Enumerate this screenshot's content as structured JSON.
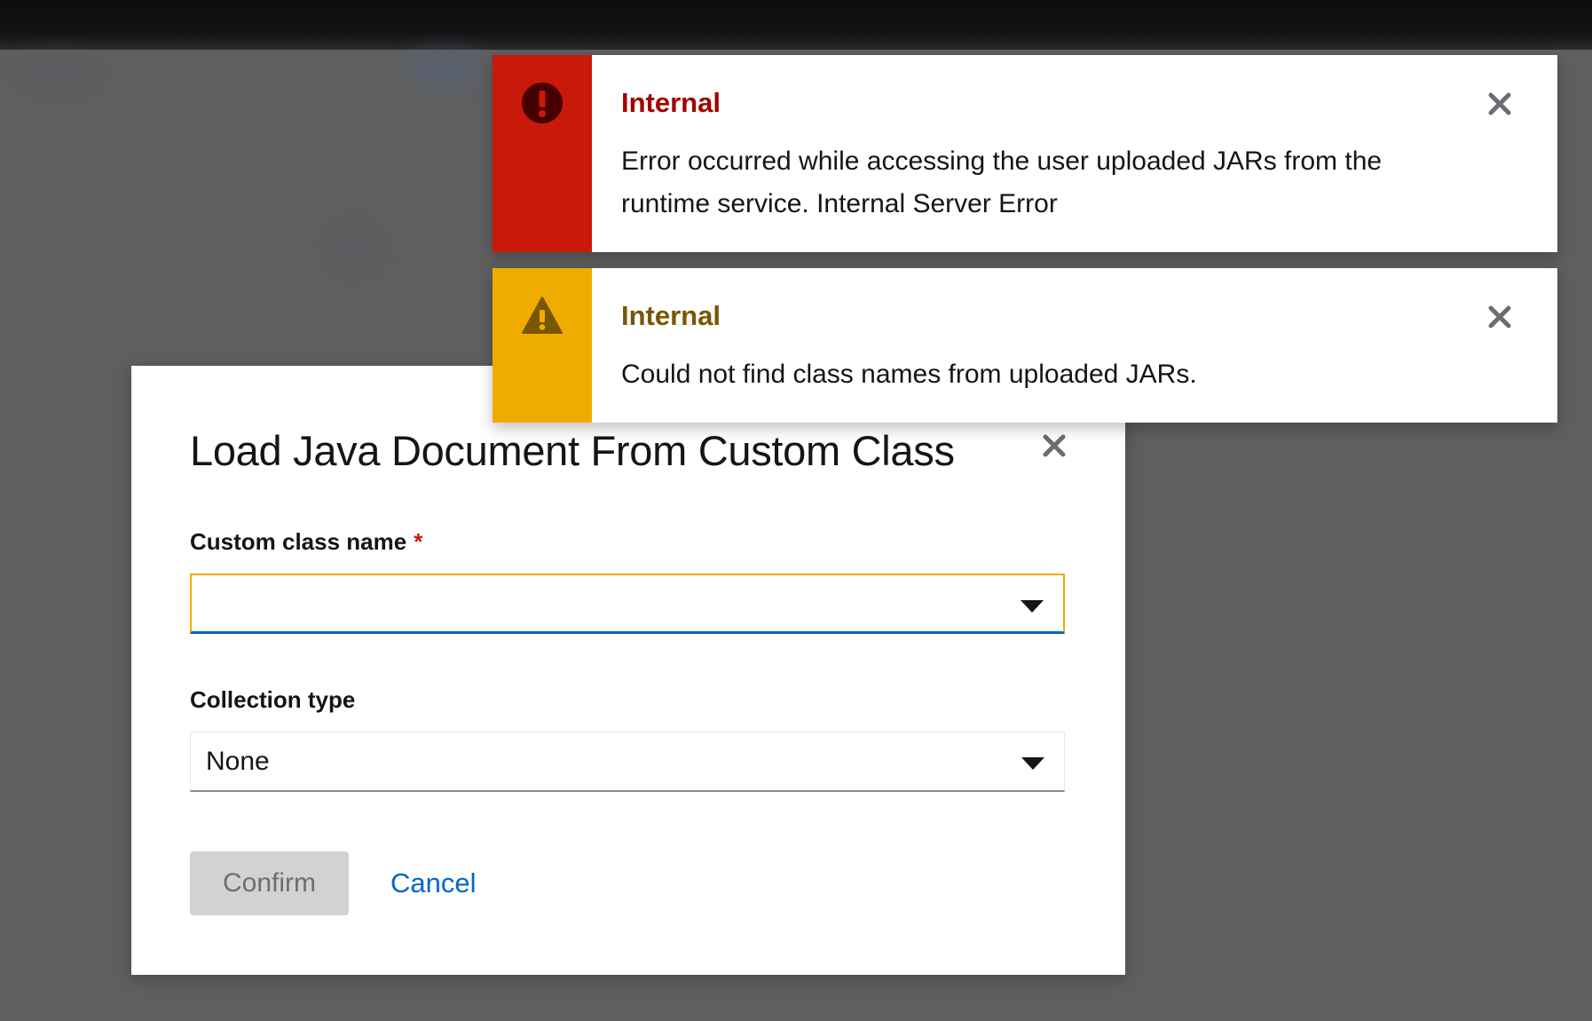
{
  "alerts": [
    {
      "variant": "danger",
      "icon": "exclamation-circle-icon",
      "color": "#c9190b",
      "title": "Internal",
      "description": "Error occurred while accessing the user uploaded JARs from the runtime service. Internal Server Error"
    },
    {
      "variant": "warning",
      "icon": "exclamation-triangle-icon",
      "color": "#f0ab00",
      "title": "Internal",
      "description": "Could not find class names from uploaded JARs."
    }
  ],
  "modal": {
    "title": "Load Java Document From Custom Class",
    "custom_class": {
      "label": "Custom class name",
      "required_marker": "*",
      "value": ""
    },
    "collection_type": {
      "label": "Collection type",
      "value": "None"
    },
    "confirm_label": "Confirm",
    "cancel_label": "Cancel"
  },
  "colors": {
    "link": "#0066cc",
    "danger": "#c9190b",
    "warning": "#f0ab00",
    "disabled_button": "#d2d2d2"
  }
}
